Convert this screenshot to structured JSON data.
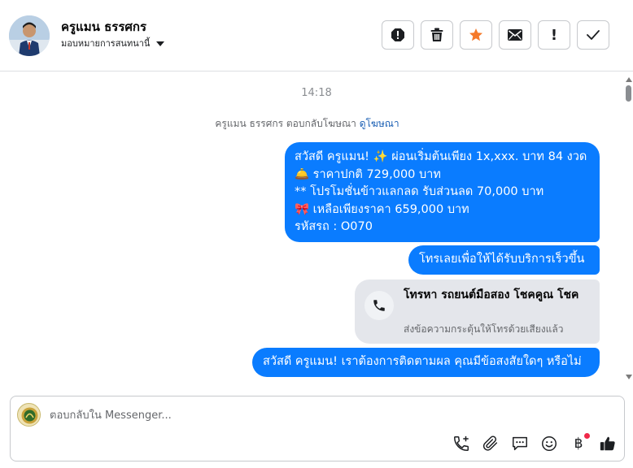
{
  "header": {
    "contact_name": "ครูแมน ธรรศกร",
    "assign_label": "มอบหมายการสนทนานี้",
    "action_icons": [
      "spam-icon",
      "trash-icon",
      "star-icon",
      "mail-icon",
      "exclamation-icon",
      "check-icon"
    ],
    "exclamation_label": "!"
  },
  "colors": {
    "bubble_blue": "#0a7cff",
    "star_orange": "#f5792a",
    "link_blue": "#1a5fb4",
    "card_gray": "#e4e6eb"
  },
  "conversation": {
    "timestamp": "14:18",
    "reply_note": "ครูแมน ธรรศกร ตอบกลับโฆษณา",
    "reply_link": "ดูโฆษณา",
    "message1": {
      "line1": "สวัสดี ครูแมน! ✨  ผ่อนเริ่มต้นเพียง 1x,xxx. บาท 84 งวด",
      "line2": "🛎️ ราคาปกติ 729,000 บาท",
      "line3": "** โปรโมชั่นข้าวแลกลด รับส่วนลด 70,000 บาท",
      "line4": "🎀  เหลือเพียงราคา 659,000 บาท",
      "line5": " รหัสรถ : O070"
    },
    "message2": "โทรเลยเพื่อให้ได้รับบริการเร็วขึ้น",
    "call_card": {
      "title": "โทรหา รถยนต์มือสอง โชคคูณ โชค",
      "subtitle": "ส่งข้อความกระตุ้นให้โทรด้วยเสียงแล้ว"
    },
    "message4": "สวัสดี ครูแมน! เราต้องการติดตามผล คุณมีข้อสงสัยใดๆ หรือไม่"
  },
  "composer": {
    "placeholder": "ตอบกลับใน Messenger...",
    "baht_symbol": "฿",
    "tool_icons": [
      "call-plus-icon",
      "paperclip-icon",
      "chat-bubble-icon",
      "emoji-icon",
      "baht-icon",
      "thumbs-up-icon"
    ]
  }
}
